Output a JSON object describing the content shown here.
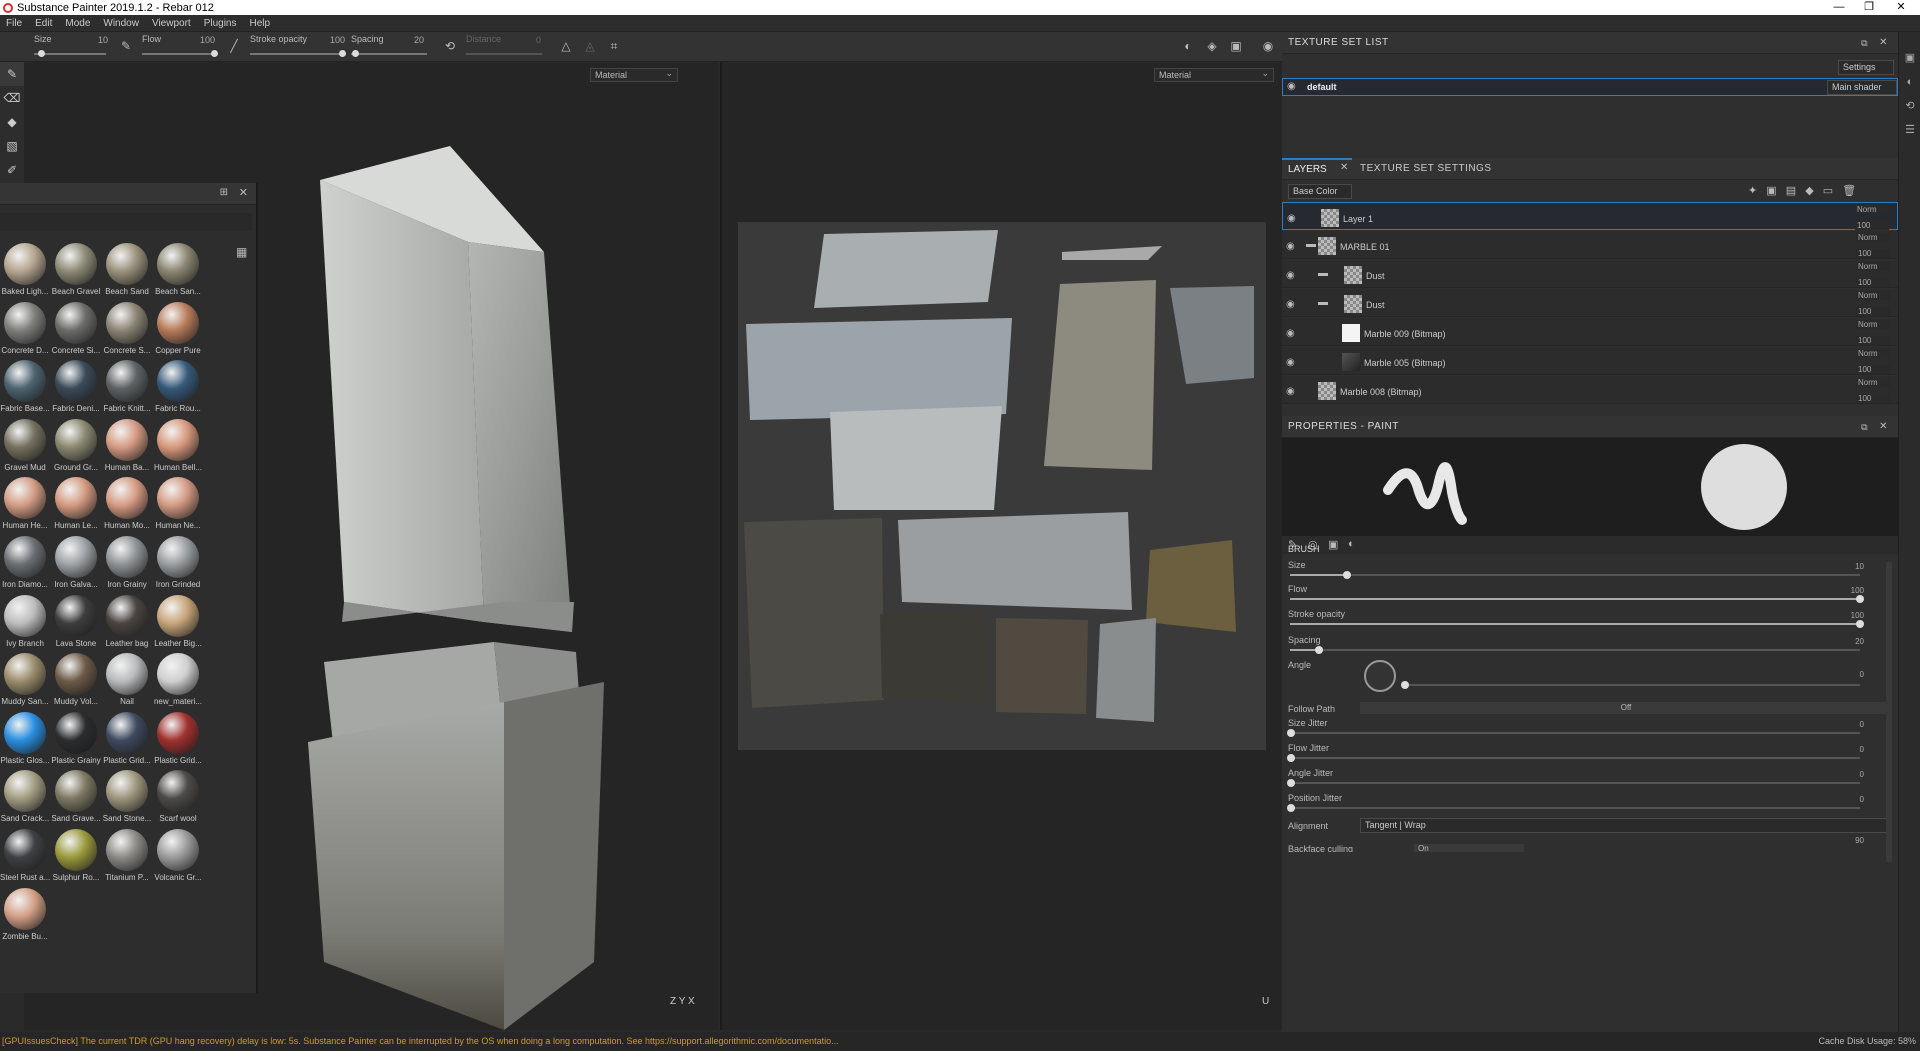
{
  "window": {
    "title": "Substance Painter 2019.1.2 - Rebar 012",
    "controls": [
      "—",
      "❐",
      "✕"
    ]
  },
  "menu": [
    "File",
    "Edit",
    "Mode",
    "Window",
    "Viewport",
    "Plugins",
    "Help"
  ],
  "toolbar": {
    "size_label": "Size",
    "size_value": "10",
    "flow_label": "Flow",
    "flow_value": "100",
    "stroke_label": "Stroke opacity",
    "stroke_value": "100",
    "spacing_label": "Spacing",
    "spacing_value": "20",
    "distance_label": "Distance",
    "distance_value": "0",
    "size_level": 0.1,
    "flow_level": 1.0,
    "stroke_level": 1.0,
    "spacing_level": 0.05
  },
  "viewports": {
    "left_mode": "Material",
    "right_mode": "Material",
    "axis_left": "Z  Y  X",
    "axis_right": "U"
  },
  "shelf": {
    "materials": [
      {
        "name": "Baked Ligh...",
        "color": "#b5a590"
      },
      {
        "name": "Beach Gravel",
        "color": "#8d8a76"
      },
      {
        "name": "Beach Sand",
        "color": "#9a927c"
      },
      {
        "name": "Beach San...",
        "color": "#8b8672"
      },
      {
        "name": "Concrete D...",
        "color": "#7f7f7b"
      },
      {
        "name": "Concrete Si...",
        "color": "#6c6d6a"
      },
      {
        "name": "Concrete S...",
        "color": "#8c8475"
      },
      {
        "name": "Copper Pure",
        "color": "#b77b5a"
      },
      {
        "name": "Fabric Base...",
        "color": "#4d6470"
      },
      {
        "name": "Fabric Deni...",
        "color": "#3b4a59"
      },
      {
        "name": "Fabric Knitt...",
        "color": "#5e6366"
      },
      {
        "name": "Fabric Rou...",
        "color": "#36597a"
      },
      {
        "name": "Gravel Mud",
        "color": "#74705f"
      },
      {
        "name": "Ground Gr...",
        "color": "#8a8870"
      },
      {
        "name": "Human Ba...",
        "color": "#d59a82"
      },
      {
        "name": "Human Bell...",
        "color": "#d7987c"
      },
      {
        "name": "Human He...",
        "color": "#d39c85"
      },
      {
        "name": "Human Le...",
        "color": "#d49a80"
      },
      {
        "name": "Human Mo...",
        "color": "#d69b83"
      },
      {
        "name": "Human Ne...",
        "color": "#d39a83"
      },
      {
        "name": "Iron Diamo...",
        "color": "#6a6f73"
      },
      {
        "name": "Iron Galva...",
        "color": "#9da2a6"
      },
      {
        "name": "Iron Grainy",
        "color": "#8f9396"
      },
      {
        "name": "Iron Grinded",
        "color": "#9a9ea1"
      },
      {
        "name": "Ivy Branch",
        "color": "#bdbdbd"
      },
      {
        "name": "Lava Stone",
        "color": "#3d3d3d"
      },
      {
        "name": "Leather bag",
        "color": "#4a4440"
      },
      {
        "name": "Leather Big...",
        "color": "#c7a57a"
      },
      {
        "name": "Muddy San...",
        "color": "#9a8d6c"
      },
      {
        "name": "Muddy Vol...",
        "color": "#6c5a46"
      },
      {
        "name": "Nail",
        "color": "#b9bbbc"
      },
      {
        "name": "new_materi...",
        "color": "#cfcfcf"
      },
      {
        "name": "Plastic Glos...",
        "color": "#2a8ee0"
      },
      {
        "name": "Plastic Grainy",
        "color": "#2b2c2e"
      },
      {
        "name": "Plastic Grid...",
        "color": "#3f4a60"
      },
      {
        "name": "Plastic Grid...",
        "color": "#a0302e"
      },
      {
        "name": "Sand Crack...",
        "color": "#a39e83"
      },
      {
        "name": "Sand Grave...",
        "color": "#7e7963"
      },
      {
        "name": "Sand Stone...",
        "color": "#9d957d"
      },
      {
        "name": "Scarf wool",
        "color": "#4d4b49"
      },
      {
        "name": "Steel Rust a...",
        "color": "#3e4044"
      },
      {
        "name": "Sulphur Ro...",
        "color": "#9a9a3c"
      },
      {
        "name": "Titanium P...",
        "color": "#8c8a86"
      },
      {
        "name": "Volcanic Gr...",
        "color": "#9a9a9a"
      },
      {
        "name": "Zombie Bu...",
        "color": "#d4a087"
      }
    ]
  },
  "texture_set_list": {
    "title": "TEXTURE SET LIST",
    "settings": "Settings",
    "set_name": "default",
    "shader": "Main shader"
  },
  "layers_panel": {
    "tab_layers": "LAYERS",
    "tab_tss": "TEXTURE SET SETTINGS",
    "channel": "Base Color",
    "layers": [
      {
        "name": "Layer 1",
        "blend": "Norm",
        "opacity": "100"
      },
      {
        "name": "MARBLE 01",
        "blend": "Norm",
        "opacity": "100"
      },
      {
        "name": "Dust",
        "blend": "Norm",
        "opacity": "100"
      },
      {
        "name": "Dust",
        "blend": "Norm",
        "opacity": "100"
      },
      {
        "name": "Marble 009 (Bitmap)",
        "blend": "Norm",
        "opacity": "100"
      },
      {
        "name": "Marble 005 (Bitmap)",
        "blend": "Norm",
        "opacity": "100"
      },
      {
        "name": "Marble 008 (Bitmap)",
        "blend": "Norm",
        "opacity": "100"
      }
    ]
  },
  "properties": {
    "title": "PROPERTIES - PAINT",
    "section": "BRUSH",
    "size_label": "Size",
    "size_value": "10",
    "flow_label": "Flow",
    "flow_value": "100",
    "stroke_label": "Stroke opacity",
    "stroke_value": "100",
    "spacing_label": "Spacing",
    "spacing_value": "20",
    "angle_label": "Angle",
    "angle_value": "0",
    "follow_label": "Follow Path",
    "follow_value": "Off",
    "size_jitter_label": "Size Jitter",
    "size_jitter_value": "0",
    "flow_jitter_label": "Flow Jitter",
    "flow_jitter_value": "0",
    "angle_jitter_label": "Angle Jitter",
    "angle_jitter_value": "0",
    "position_jitter_label": "Position Jitter",
    "position_jitter_value": "0",
    "alignment_label": "Alignment",
    "alignment_value": "Tangent | Wrap",
    "backface_label": "Backface culling",
    "backface_value": "On",
    "backface_angle": "90"
  },
  "status": {
    "message": "[GPUIssuesCheck] The current TDR (GPU hang recovery) delay is low: 5s. Substance Painter can be interrupted by the OS when doing a long computation. See https://support.allegorithmic.com/documentatio...",
    "cache": "Cache Disk Usage:  58%"
  },
  "colors": {
    "accent": "#2a7fc4",
    "warning": "#d09a2e"
  }
}
